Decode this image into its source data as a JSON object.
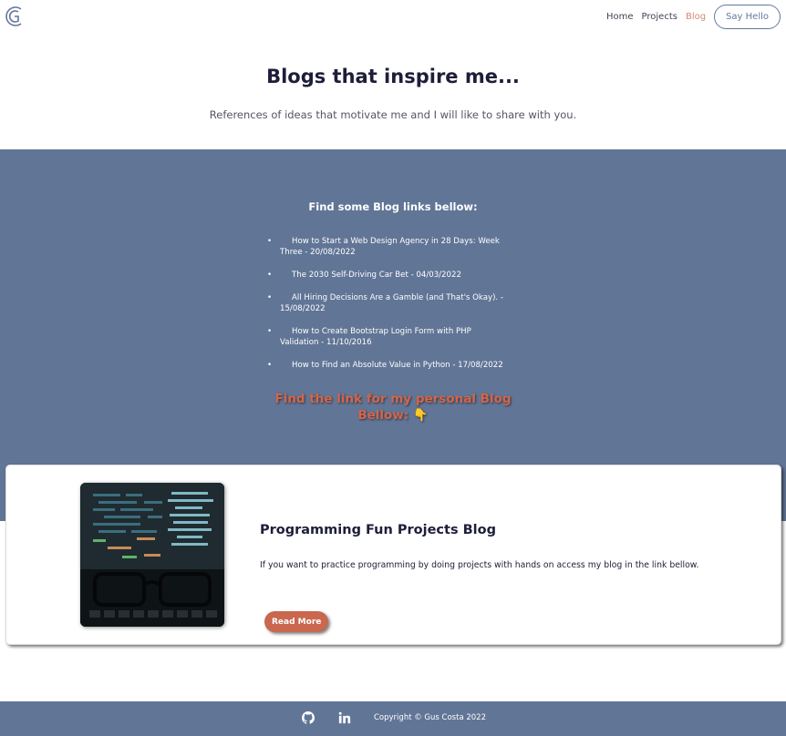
{
  "nav": {
    "logo_icon": "g-logo-icon",
    "links": [
      {
        "label": "Home"
      },
      {
        "label": "Projects"
      },
      {
        "label": "Blog"
      }
    ],
    "active_link": "Blog",
    "hello_label": "Say Hello",
    "active_color": "#d38a73"
  },
  "hero": {
    "title": "Blogs that inspire me...",
    "subtitle": "References of ideas that motivate me and I will like to share with you."
  },
  "blogs": {
    "heading": "Find some Blog links bellow:",
    "items": [
      {
        "label": "How to Start a Web Design Agency in 28 Days: Week Three - 20/08/2022"
      },
      {
        "label": "The 2030 Self-Driving Car Bet - 04/03/2022"
      },
      {
        "label": "All Hiring Decisions Are a Gamble (and That's Okay). - 15/08/2022"
      },
      {
        "label": "How to Create Bootstrap Login Form with PHP Validation - 11/10/2016"
      },
      {
        "label": "How to Find an Absolute Value in Python - 17/08/2022"
      }
    ],
    "personal_line1": "Find the link for my personal Blog",
    "personal_line2": "Bellow: 👇"
  },
  "card": {
    "image": "laptop-code-glasses-image",
    "title": "Programming Fun Projects Blog",
    "text": "If you want to practice programming by doing projects with hands on access my blog in the link bellow.",
    "button_label": "Read More",
    "button_color": "#c9674f"
  },
  "footer": {
    "icons": [
      "github-icon",
      "linkedin-icon"
    ],
    "copyright": "Copyright © Gus Costa 2022",
    "background": "#617596"
  }
}
